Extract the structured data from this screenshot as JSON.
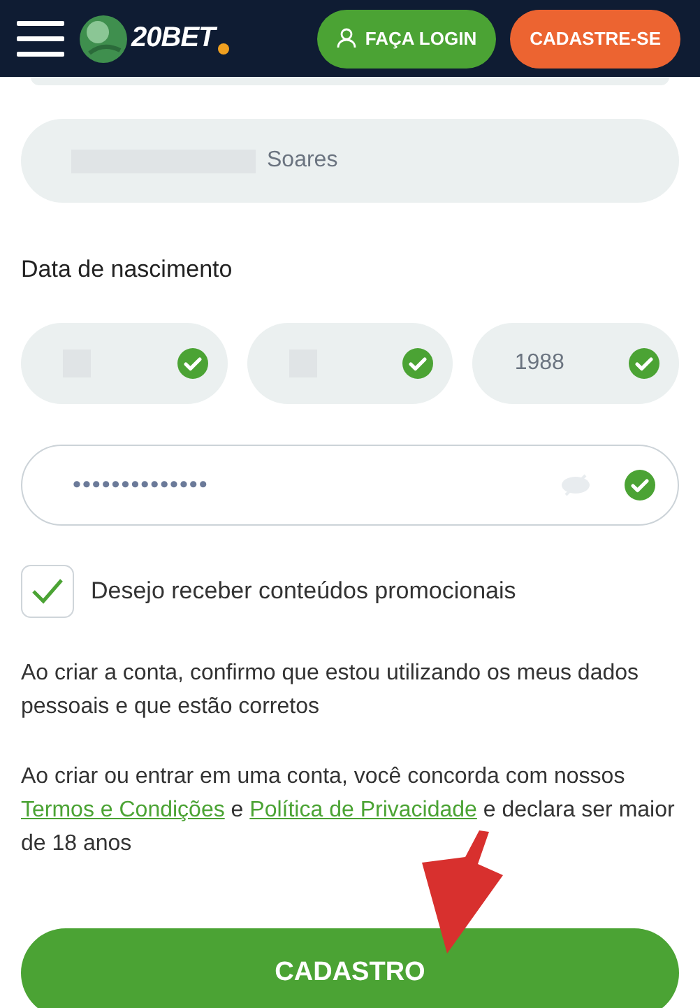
{
  "header": {
    "logo": "20BET",
    "buttons": [
      {
        "label": "FAÇA LOGIN",
        "kind": "login"
      },
      {
        "label": "CADASTRE-SE",
        "kind": "signup"
      }
    ]
  },
  "surname_field": {
    "value": "Soares",
    "redacted": true
  },
  "birth_date": {
    "label": "Data de nascimento",
    "fields": [
      {
        "redacted": true,
        "valid": true
      },
      {
        "redacted": true,
        "valid": true
      },
      {
        "value": "1988",
        "redacted": false,
        "valid": true
      }
    ]
  },
  "password_field": {
    "value": "••••••••••••••",
    "valid": true
  },
  "promo_checkbox": {
    "label": "Desejo receber conteúdos promocionais",
    "checked": true
  },
  "confirm_text": "Ao criar a conta, confirmo que estou utilizando os meus dados pessoais e que estão corretos",
  "terms_text": {
    "before": "Ao criar ou entrar em uma conta, você concorda com nossos",
    "link_terms": "Termos e Condições",
    "middle": "e",
    "link_privacy": "Política de Privacidade",
    "after": "e declara ser maior de 18 anos"
  },
  "submit_button": "CADASTRO"
}
